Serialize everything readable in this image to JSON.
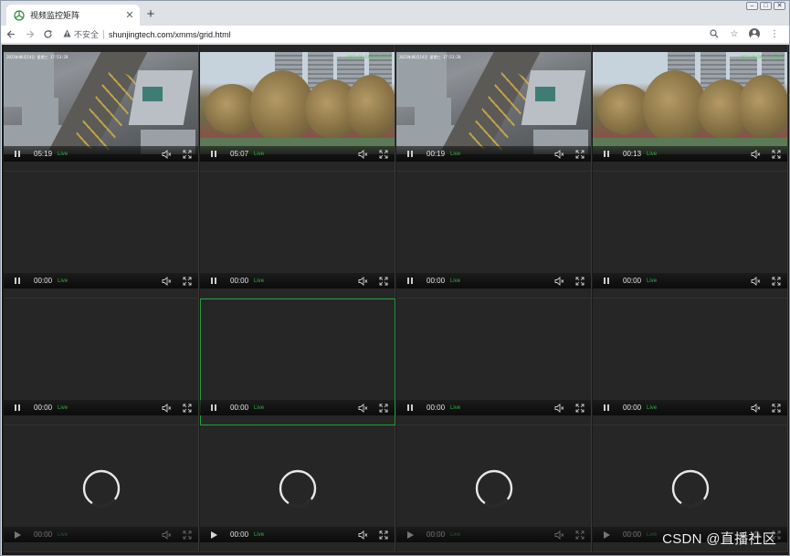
{
  "browser": {
    "tab_title": "视频监控矩阵",
    "new_tab_glyph": "+",
    "security_text": "不安全",
    "url": "shunjingtech.com/xmms/grid.html"
  },
  "grid": {
    "live_label": "Live",
    "rows": [
      [
        {
          "time": "05:19",
          "feed": "city",
          "osd": "2023年06月14日 星期三 17:53:28"
        },
        {
          "time": "05:07",
          "feed": "park",
          "osd": "2023-06-14 17:53:28"
        },
        {
          "time": "00:19",
          "feed": "city",
          "osd": "2023年06月14日 星期三 17:53:28"
        },
        {
          "time": "00:13",
          "feed": "park",
          "osd": "2023-06-14 17:53:28"
        }
      ],
      [
        {
          "time": "00:00"
        },
        {
          "time": "00:00"
        },
        {
          "time": "00:00"
        },
        {
          "time": "00:00"
        }
      ],
      [
        {
          "time": "00:00"
        },
        {
          "time": "00:00",
          "selected": true
        },
        {
          "time": "00:00"
        },
        {
          "time": "00:00"
        }
      ],
      [
        {
          "time": "00:00",
          "loading": true
        },
        {
          "time": "00:00",
          "loading": true
        },
        {
          "time": "00:00",
          "loading": true
        },
        {
          "time": "00:00",
          "loading": true
        }
      ]
    ]
  },
  "watermark": "CSDN @直播社区",
  "colors": {
    "live_green": "#2fb344",
    "selected_border": "#21a035"
  }
}
